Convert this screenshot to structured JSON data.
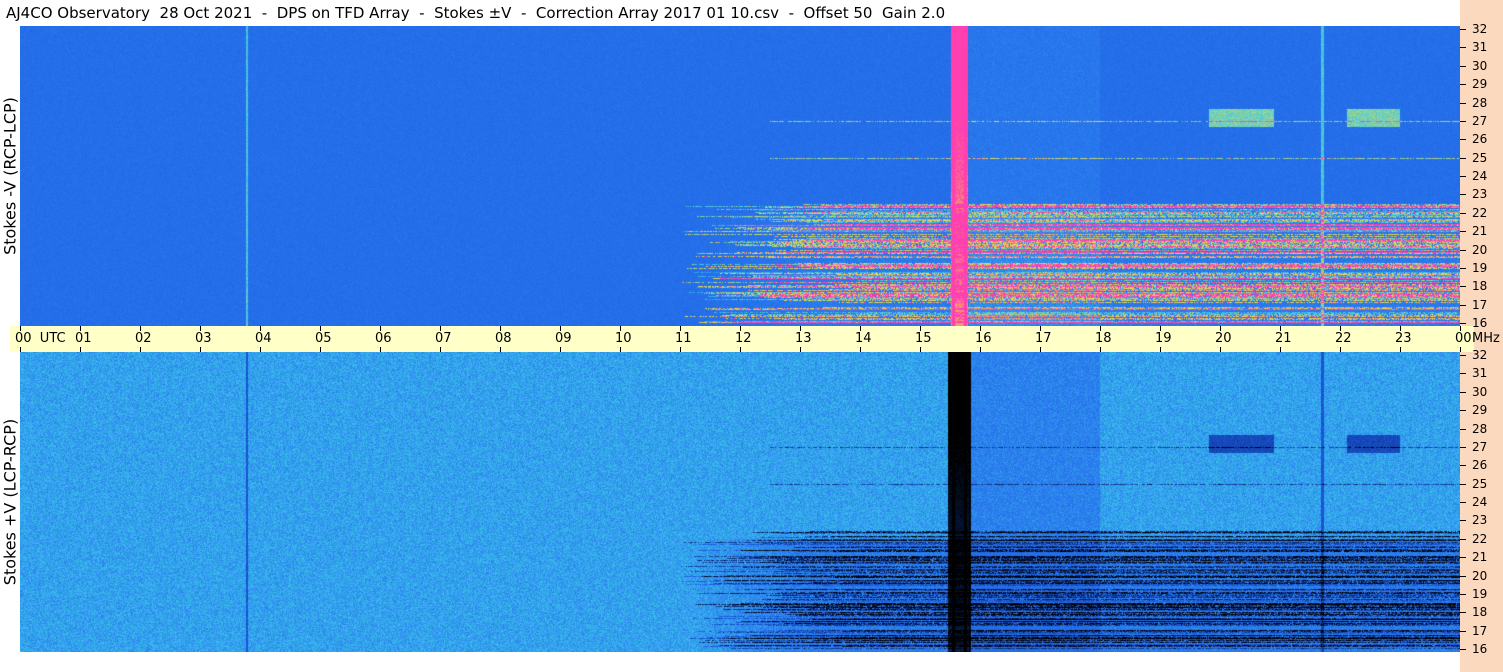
{
  "header": {
    "title": "AJ4CO Observatory  28 Oct 2021  -  DPS on TFD Array  -  Stokes ±V  -  Correction Array 2017 01 10.csv  -  Offset 50  Gain 2.0"
  },
  "panels": [
    {
      "ylabel": "Stokes -V (RCP-LCP)"
    },
    {
      "ylabel": "Stokes +V (LCP-RCP)"
    }
  ],
  "time_axis": {
    "labels": [
      "00  UTC",
      "01",
      "02",
      "03",
      "04",
      "05",
      "06",
      "07",
      "08",
      "09",
      "10",
      "11",
      "12",
      "13",
      "14",
      "15",
      "16",
      "17",
      "18",
      "19",
      "20",
      "21",
      "22",
      "23",
      "00"
    ],
    "unit": "MHz"
  },
  "colors": {
    "background_low": "#1a58e0",
    "background_mid": "#2a7aee",
    "high": "#f0e040",
    "peak": "#ff40b0",
    "dark": "#000000",
    "axis_band": "#ffffc8",
    "right_strip": "#fbd9bf"
  },
  "chart_data": [
    {
      "type": "heatmap",
      "title": "Stokes -V (RCP-LCP)",
      "xlabel": "UTC",
      "ylabel": "MHz",
      "x_ticks": [
        "00",
        "01",
        "02",
        "03",
        "04",
        "05",
        "06",
        "07",
        "08",
        "09",
        "10",
        "11",
        "12",
        "13",
        "14",
        "15",
        "16",
        "17",
        "18",
        "19",
        "20",
        "21",
        "22",
        "23",
        "00"
      ],
      "y_ticks": [
        16,
        17,
        18,
        19,
        20,
        21,
        22,
        23,
        24,
        25,
        26,
        27,
        28,
        29,
        30,
        31,
        32
      ],
      "ylim": [
        16,
        32
      ],
      "xlim_hours": [
        0,
        24
      ],
      "features": {
        "vertical_bursts_hours": [
          3.77,
          15.55,
          15.75,
          21.7
        ],
        "strong_emission_hours": [
          15.5,
          15.8
        ],
        "emission_patches": [
          {
            "hours": [
              19.8,
              20.9
            ],
            "mhz": 27.2
          },
          {
            "hours": [
              22.1,
              23.0
            ],
            "mhz": 27.2
          }
        ],
        "enhanced_band_hours": [
          11.2,
          24.0
        ],
        "enhanced_band_mhz": [
          16,
          22
        ]
      }
    },
    {
      "type": "heatmap",
      "title": "Stokes +V (LCP-RCP)",
      "xlabel": "UTC",
      "ylabel": "MHz",
      "x_ticks": [
        "00",
        "01",
        "02",
        "03",
        "04",
        "05",
        "06",
        "07",
        "08",
        "09",
        "10",
        "11",
        "12",
        "13",
        "14",
        "15",
        "16",
        "17",
        "18",
        "19",
        "20",
        "21",
        "22",
        "23",
        "00"
      ],
      "y_ticks": [
        16,
        17,
        18,
        19,
        20,
        21,
        22,
        23,
        24,
        25,
        26,
        27,
        28,
        29,
        30,
        31,
        32
      ],
      "ylim": [
        16,
        32
      ],
      "xlim_hours": [
        0,
        24
      ],
      "features": {
        "vertical_bursts_hours": [
          3.77,
          15.55,
          15.75,
          21.7
        ],
        "dark_emission_hours": [
          15.45,
          15.85
        ],
        "dark_patches": [
          {
            "hours": [
              19.8,
              20.9
            ],
            "mhz": 27.2
          },
          {
            "hours": [
              22.1,
              23.0
            ],
            "mhz": 27.2
          }
        ],
        "enhanced_band_hours": [
          11.2,
          24.0
        ],
        "enhanced_band_mhz": [
          16,
          22
        ]
      }
    }
  ]
}
